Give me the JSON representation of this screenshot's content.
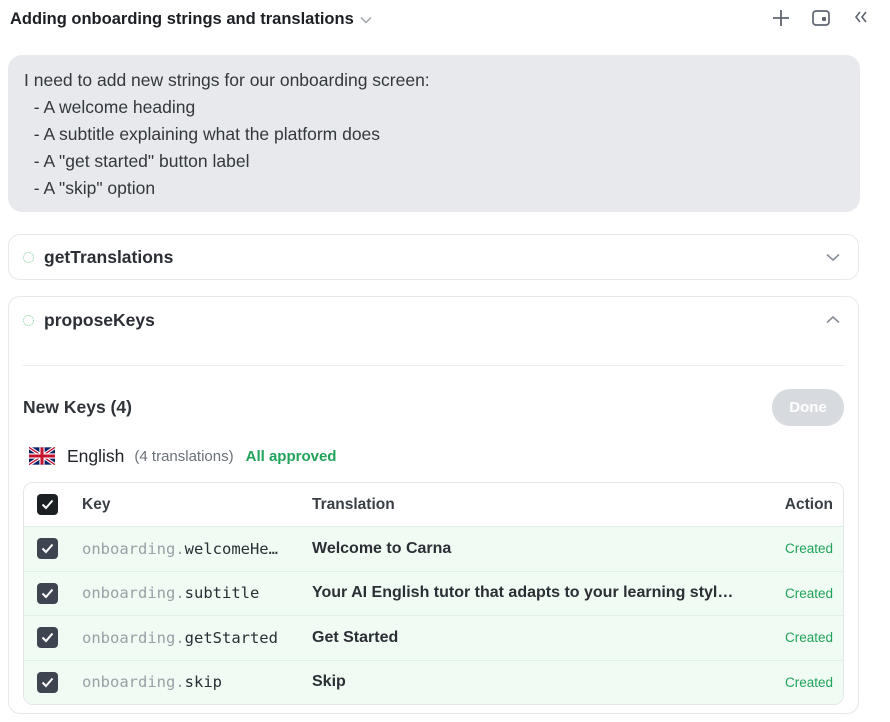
{
  "header": {
    "title": "Adding onboarding strings and translations"
  },
  "message": {
    "lines": [
      "I need to add new strings for our onboarding screen:",
      "  - A welcome heading",
      "  - A subtitle explaining what the platform does",
      "  - A \"get started\" button label",
      "  - A \"skip\" option"
    ]
  },
  "tools": {
    "get_translations": {
      "label": "getTranslations"
    },
    "propose_keys": {
      "label": "proposeKeys",
      "new_keys_label": "New Keys (4)",
      "done_label": "Done",
      "language": {
        "name": "English",
        "count": "(4 translations)",
        "status": "All approved"
      },
      "table": {
        "headers": {
          "key": "Key",
          "translation": "Translation",
          "action": "Action"
        },
        "rows": [
          {
            "key_ns": "onboarding.",
            "key_name": "welcomeHe…",
            "translation": "Welcome to Carna",
            "action": "Created"
          },
          {
            "key_ns": "onboarding.",
            "key_name": "subtitle",
            "translation": "Your AI English tutor that adapts to your learning styl…",
            "action": "Created"
          },
          {
            "key_ns": "onboarding.",
            "key_name": "getStarted",
            "translation": "Get Started",
            "action": "Created"
          },
          {
            "key_ns": "onboarding.",
            "key_name": "skip",
            "translation": "Skip",
            "action": "Created"
          }
        ]
      }
    }
  },
  "colors": {
    "accent_green": "#22a35a",
    "row_bg": "#effbf3",
    "message_bg": "#e7e9ec"
  }
}
